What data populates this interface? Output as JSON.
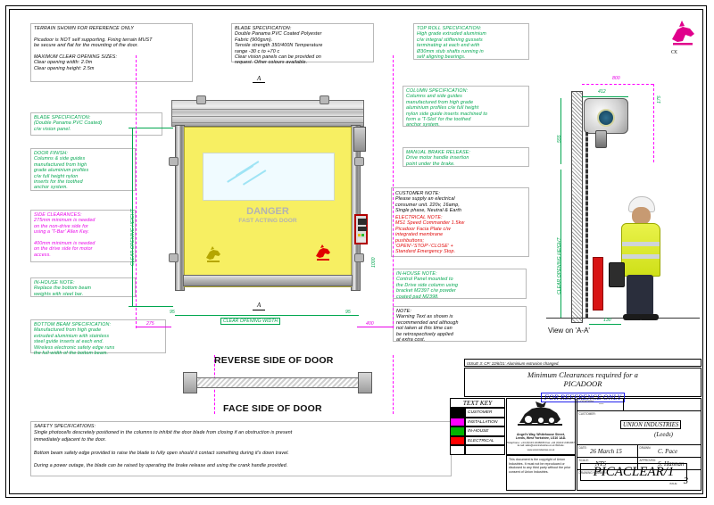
{
  "notes": {
    "terrain": "TERRAIN SHOWN FOR REFERENCE ONLY\n\nPicadoor is NOT self supporting. Fixing terrain MUST\nbe secure and flat for the mounting of the door.\n\nMAXIMUM CLEAR OPENING SIZES:\nClear opening width: 2.0m\nClear opening height: 2.5m",
    "blade_spec_green": "BLADE SPECIFICATION:\n(Double Panama PVC Coated)\nc/w vision panel.",
    "door_finish": "DOOR FINISH:\nColumns & side guides\nmanufactured from high\ngrade aluminium profiles\nc/w full height nylon\ninserts for the toothed\nanchor system.",
    "side_clearances": "SIDE CLEARANCES:\n275mm minimum is needed\non the non-drive side for\nusing a 'T-Bar' Allen Key.\n\n400mm minimum is needed\non the drive side for motor\naccess.",
    "inhouse_bottom": "IN-HOUSE NOTE:\nReplace the bottom beam\nweights with steel bar.",
    "bottom_beam": "BOTTOM BEAM SPECIFICATION:\nManufactured from high grade\nextruded aluminium with stainless\nsteel guide inserts at each end.\nWireless electronic safety edge runs\nthe full width of the bottom beam.",
    "blade_spec_black": "BLADE SPECIFICATION:\nDouble Panama PVC Coated Polyester\nFabric (900gsm).\nTensile strength 350/400N Temperature\nrange -30 c to +70 c\nClear vision panels can be provided on\nrequest. Other colours available.",
    "top_roll": "TOP ROLL SPECIFICATION:\nHigh grade extruded aluminium\nc/w integral stiffening gussets\nterminating at each end with\nØ30mm stub shafts running in\nself aligning bearings.",
    "column_spec": "COLUMN SPECIFICATION:\nColumns and side guides\nmanufactured from high grade\naluminium profiles c/w full height\nnylon side guide inserts machined to\nform a 'T-Slot' for the toothed\nanchor system.",
    "manual_brake": "MANUAL BRAKE RELEASE:\nDrive motor handle insertion\npoint under the brake.",
    "customer_note": "CUSTOMER NOTE:\nPlease supply an electrical\nconsumer unit. 220v, 16amp,\nSingle phase, Neutral & Earth",
    "electrical_note": "ELECTRICAL NOTE:\nMS1 Speed Commander 1.5kw\nPicadoor Facia Plate c/w\nintegrated membrane\npushbuttons;\n'OPEN'-'STOP'-'CLOSE' +\nStandard Emergency Stop.",
    "inhouse_panel": "IN-HOUSE NOTE:\nControl Panel mounted to\nthe Drive side column using\nbracket M2397 c/w powder\ncoated pad M2398.",
    "warning_note": "NOTE:\nWarning Text as shown is\nrecommended and although\nnot taken at this time can\nbe retrospectively applied\nat extra cost.",
    "safety": "SAFETY SPECIFICATIONS:\nSingle photocells descretely positioned in the columns to inhibit the door blade from closing if an obstruction is present\nimmediately adjacent to the door.\n\nBottom beam safety edge provided to raise the blade to fully open should it contact something during it's down travel.\n\nDuring a power outage, the blade can be raised by operating the brake release and using the crank handle provided."
  },
  "captions": {
    "reverse_side": "REVERSE SIDE OF DOOR",
    "face_side": "FACE SIDE OF DOOR",
    "view_aa": "View on 'A-A'",
    "danger_big": "DANGER",
    "danger_small": "FAST ACTING DOOR",
    "section_a_top": "A",
    "section_a_bottom": "A"
  },
  "dimensions": {
    "clear_opening_height": "CLEAR OPENING HEIGHT",
    "clear_opening_width": "CLEAR OPENING WIDTH",
    "clear_opening_height_side": "CLEAR OPENING HEIGHT",
    "left_clearance": "275",
    "right_clearance": "400",
    "left_gap": "95",
    "right_gap": "95",
    "door_height_mm": "1000",
    "side_800": "800",
    "side_412": "412",
    "side_175": "175",
    "side_555": "555",
    "side_130": "130"
  },
  "title_block": {
    "issue_line": "ISSUE 3: CP: 22/6/21: Aluminium extrusion changed.",
    "title_line1": "Minimum Clearances required for a",
    "title_line2": "PICADOOR",
    "title_line3": "FOR REFERENCE ONLY",
    "text_key_header": "TEXT KEY",
    "text_key": [
      {
        "label": "CUSTOMER",
        "color": "#000000"
      },
      {
        "label": "INSTALLATION",
        "color": "#ff00ff"
      },
      {
        "label": "IN-HOUSE",
        "color": "#00b400"
      },
      {
        "label": "ELECTRICAL",
        "color": "#ff0000"
      },
      {
        "label": "",
        "color": "#ffffff"
      }
    ],
    "address_line1": "Angel's Way, Whitehouse Street,",
    "address_line2": "Leeds, West Yorkshire, LS10 1AD.",
    "address_line3": "Telephone: +44 (0)113 2446006   Fax +44 (0)113 2461967",
    "address_line4": "E-mail: sales@unionindustries.co.uk   Website: www.unionindustries.co.uk",
    "copyright": "This document is the copyright of Union Industries. It must not be reproduced or disclosed to any third party without the prior consent of Union Industries.",
    "label_location": "LOCATION:",
    "value_location": "—",
    "label_customer": "CUSTOMER:",
    "value_customer1": "UNION INDUSTRIES",
    "value_customer2": "(Leeds)",
    "label_date": "DATE:",
    "value_date": "26 March 15",
    "label_drawn": "DRAWN:",
    "value_drawn": "C. Pace",
    "label_scale": "SCALE:",
    "value_scale": "NTS",
    "label_approved": "APPROVED:",
    "value_approved": "S. Hannan",
    "label_drawing_number": "DRAWING NUMBER:",
    "value_drawing_number": "PICACLEAR/1",
    "label_issue": "ISSUE:",
    "value_issue": "3"
  },
  "colors": {
    "green": "#00a64f",
    "magenta": "#e800e8",
    "red": "#d81414",
    "blue": "#2222ee",
    "curtain": "#f7ef62"
  }
}
